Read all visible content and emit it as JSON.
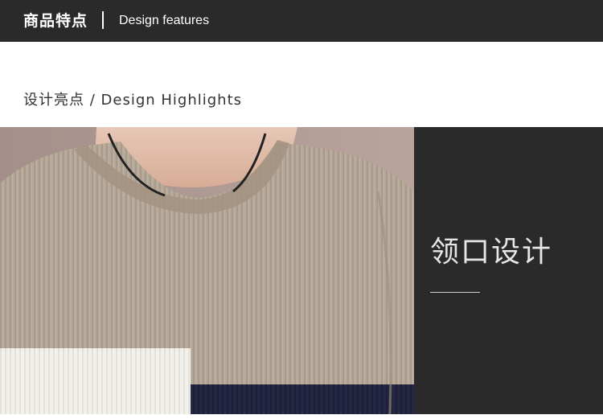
{
  "header": {
    "title_cn": "商品特点",
    "title_en": "Design features"
  },
  "section": {
    "subtitle": "设计亮点 / Design Highlights"
  },
  "feature": {
    "title": "领口设计"
  },
  "colors": {
    "dark": "#2a2a2a",
    "sweater": "#b3a596",
    "background_wall": "#b09a94",
    "white_block": "#f2f0ea",
    "navy_block": "#222640"
  },
  "image": {
    "description_icon": "sweater-collar-photo"
  }
}
